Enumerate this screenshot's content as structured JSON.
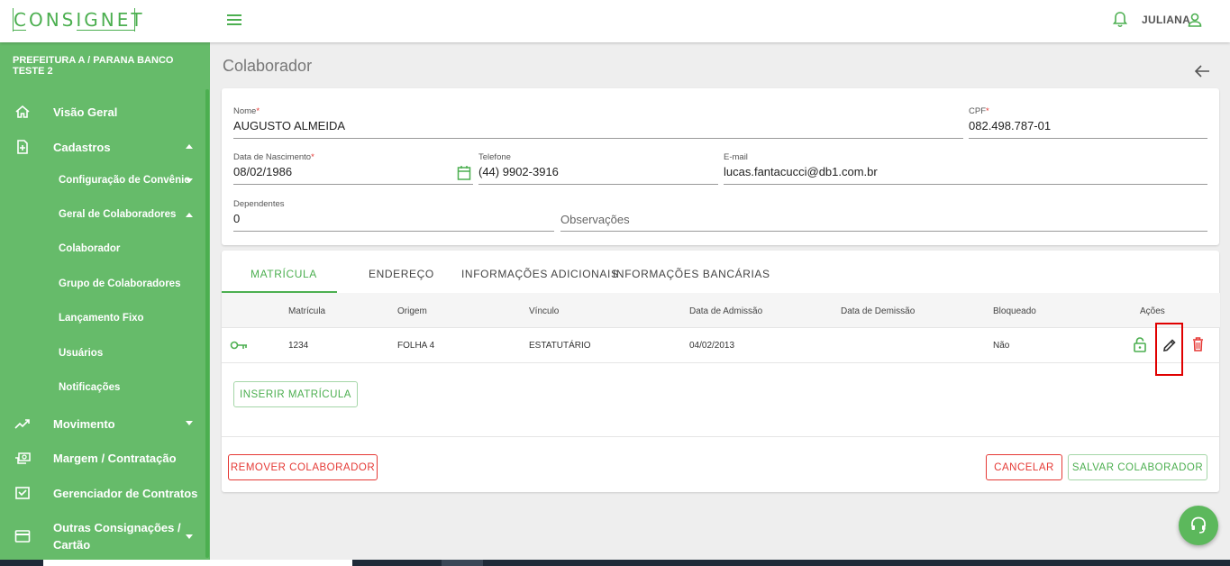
{
  "app": {
    "logo_text": "CONSIGNET",
    "user_name": "JULIANA"
  },
  "sidebar": {
    "org": "PREFEITURA A / PARANA BANCO TESTE 2",
    "items": [
      {
        "label": "Visão Geral",
        "icon": "home-icon"
      },
      {
        "label": "Cadastros",
        "icon": "file-add-icon"
      },
      {
        "label": "Movimento",
        "icon": "trending-up-icon"
      },
      {
        "label": "Margem / Contratação",
        "icon": "money-icon"
      },
      {
        "label": "Gerenciador de Contratos",
        "icon": "checkbox-icon"
      },
      {
        "label": "Outras Consignações / Cartão",
        "icon": "card-icon"
      }
    ],
    "subitems": [
      "Configuração de Convênio",
      "Geral de Colaboradores",
      "Colaborador",
      "Grupo de Colaboradores",
      "Lançamento Fixo",
      "Usuários",
      "Notificações"
    ]
  },
  "page": {
    "title": "Colaborador"
  },
  "form": {
    "nome_label": "Nome",
    "nome": "AUGUSTO ALMEIDA",
    "cpf_label": "CPF",
    "cpf": "082.498.787-01",
    "nasc_label": "Data de Nascimento",
    "nasc": "08/02/1986",
    "tel_label": "Telefone",
    "tel": "(44) 9902-3916",
    "email_label": "E-mail",
    "email": "lucas.fantacucci@db1.com.br",
    "dep_label": "Dependentes",
    "dep": "0",
    "obs_placeholder": "Observações",
    "required_mark": "*"
  },
  "tabs": [
    "MATRÍCULA",
    "ENDEREÇO",
    "INFORMAÇÕES ADICIONAIS",
    "INFORMAÇÕES BANCÁRIAS"
  ],
  "table": {
    "headers": [
      "Matrícula",
      "Origem",
      "Vínculo",
      "Data de Admissão",
      "Data de Demissão",
      "Bloqueado",
      "Ações"
    ],
    "rows": [
      {
        "matricula": "1234",
        "origem": "FOLHA 4",
        "vinculo": "ESTATUTÁRIO",
        "admissao": "04/02/2013",
        "demissao": "",
        "bloqueado": "Não"
      }
    ]
  },
  "buttons": {
    "inserir": "INSERIR MATRÍCULA",
    "remover": "REMOVER COLABORADOR",
    "cancelar": "CANCELAR",
    "salvar": "SALVAR COLABORADOR"
  },
  "colors": {
    "primary": "#4caf50",
    "sidebar": "#66bb6a",
    "danger": "#e53935"
  }
}
